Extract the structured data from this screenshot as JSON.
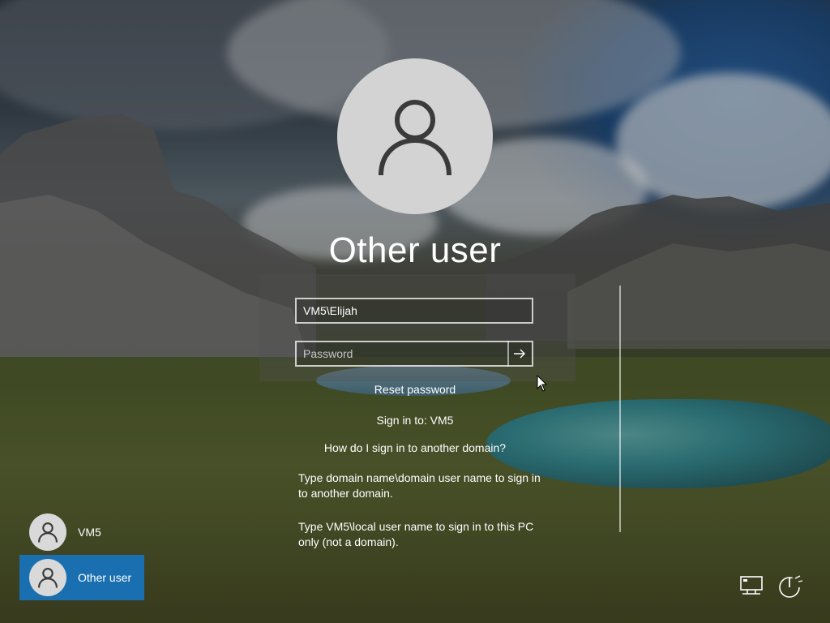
{
  "login": {
    "title": "Other user",
    "username_value": "VM5\\Elijah",
    "password_placeholder": "Password",
    "reset_password": "Reset password",
    "sign_in_to": "Sign in to: VM5",
    "how_do_i": "How do I sign in to another domain?",
    "help_text_1": "Type domain name\\domain user name to sign in to another domain.",
    "help_text_2": "Type VM5\\local user name to sign in to this PC only (not a domain)."
  },
  "users": [
    {
      "label": "VM5",
      "icon": "user-avatar-icon"
    },
    {
      "label": "Other user",
      "icon": "user-avatar-icon",
      "selected": true
    }
  ],
  "system_icons": [
    "network-icon",
    "ease-of-access-icon",
    "power-icon"
  ],
  "colors": {
    "selected_user_bg": "#1a6fb0",
    "avatar_bg": "#d3d3d3"
  }
}
